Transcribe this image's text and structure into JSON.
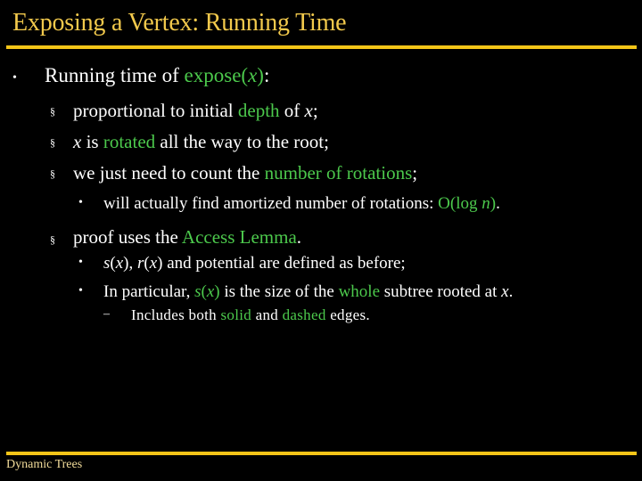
{
  "slide": {
    "title": "Exposing a Vertex: Running Time",
    "footer": "Dynamic Trees",
    "accent_color": "#f5c518",
    "highlight_color": "#4cc94c"
  },
  "content": {
    "bullet1": {
      "pre": "Running time of ",
      "hl": "expose(",
      "var": "x",
      "hl2": ")",
      "post": ":"
    },
    "sub1": {
      "pre": "proportional to initial ",
      "hl": "depth",
      "mid": " of ",
      "var": "x",
      "post": ";"
    },
    "sub2": {
      "var": "x",
      "mid": " is ",
      "hl": "rotated",
      "post": " all the way to the root;"
    },
    "sub3": {
      "pre": "we just need to count the ",
      "hl": "number of rotations",
      "post": ";"
    },
    "sub3a": {
      "pre": "will actually find amortized number of rotations: ",
      "hl": "O(log ",
      "var": "n",
      "hl2": ")",
      "post": "."
    },
    "sub4": {
      "pre": "proof uses the ",
      "hl": "Access Lemma",
      "post": "."
    },
    "sub4a": {
      "s": "s",
      "x1": "x",
      "r": "r",
      "x2": "x",
      "post": " and potential are defined as before;"
    },
    "sub4b": {
      "pre": "In particular, ",
      "hl_s": "s",
      "hl_x": "x",
      "mid": " is the size of the ",
      "hl": "whole",
      "post": " subtree rooted at ",
      "var": "x",
      "end": "."
    },
    "sub4b_i": {
      "pre": "Includes both ",
      "hl1": "solid",
      "mid": " and ",
      "hl2": "dashed",
      "post": " edges."
    }
  },
  "bullets": {
    "level1": "•",
    "level2": "§",
    "level3": "•",
    "level4": "–"
  }
}
